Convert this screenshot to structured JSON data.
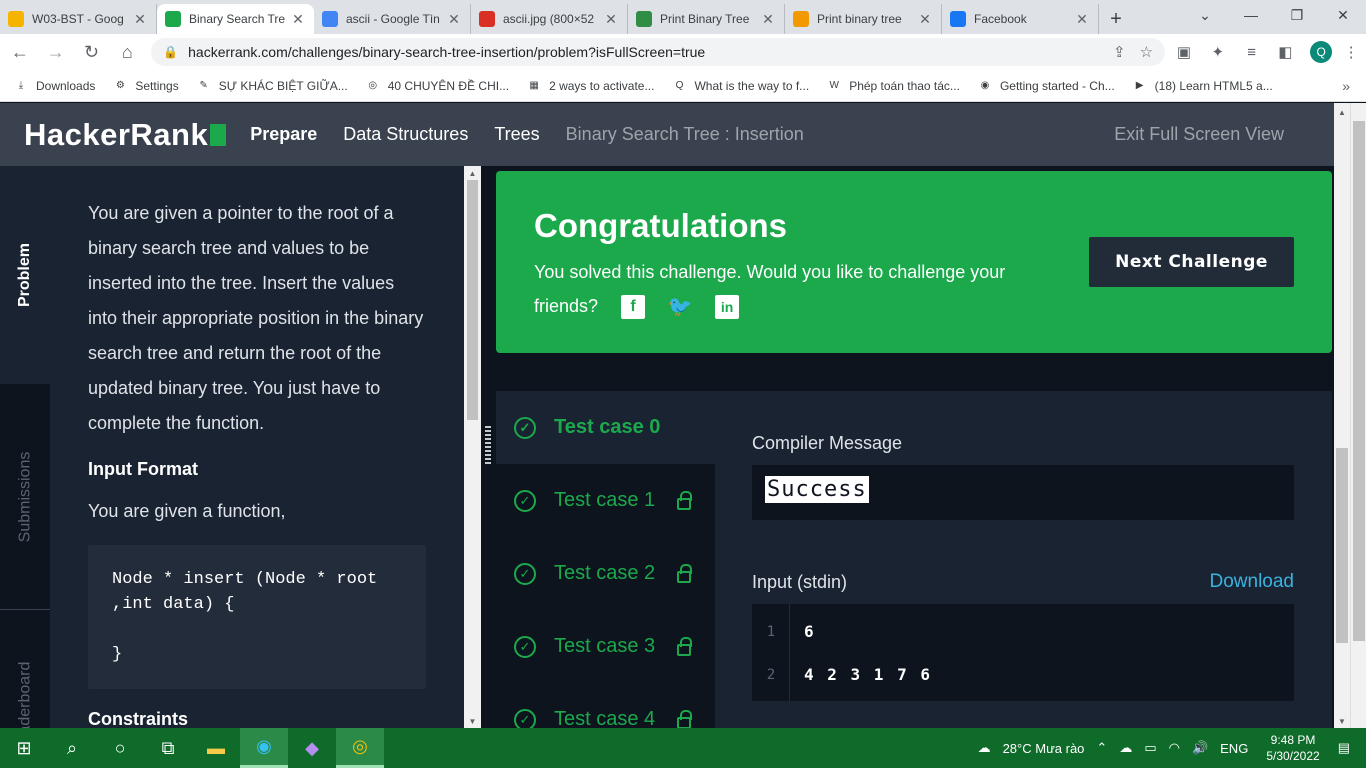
{
  "browser": {
    "tabs": [
      {
        "title": "W03-BST - Goog",
        "icon": "google-drive-icon",
        "color": "#f4b400",
        "active": false
      },
      {
        "title": "Binary Search Tre",
        "icon": "hackerrank-icon",
        "color": "#1ba94c",
        "active": true
      },
      {
        "title": "ascii - Google Tìn",
        "icon": "google-icon",
        "color": "#4285f4",
        "active": false
      },
      {
        "title": "ascii.jpg (800×52",
        "icon": "image-file-icon",
        "color": "#d93025",
        "active": false
      },
      {
        "title": "Print Binary Tree",
        "icon": "gfg-icon",
        "color": "#2f8d46",
        "active": false
      },
      {
        "title": "Print binary tree",
        "icon": "bookmark-icon",
        "color": "#f29900",
        "active": false
      },
      {
        "title": "Facebook",
        "icon": "facebook-icon",
        "color": "#1877f2",
        "active": false
      }
    ],
    "url": "hackerrank.com/challenges/binary-search-tree-insertion/problem?isFullScreen=true",
    "profile_initial": "Q"
  },
  "bookmarks": [
    {
      "label": "Downloads",
      "icon": "download-icon"
    },
    {
      "label": "Settings",
      "icon": "gear-icon"
    },
    {
      "label": "SỰ KHÁC BIỆT GIỮA...",
      "icon": "note-icon"
    },
    {
      "label": "40 CHUYÊN ĐỀ CHI...",
      "icon": "target-icon"
    },
    {
      "label": "2 ways to activate...",
      "icon": "windows-icon"
    },
    {
      "label": "What is the way to f...",
      "icon": "quora-icon"
    },
    {
      "label": "Phép toán thao tác...",
      "icon": "wikipedia-icon"
    },
    {
      "label": "Getting started - Ch...",
      "icon": "chrome-icon"
    },
    {
      "label": "(18) Learn HTML5 a...",
      "icon": "youtube-icon"
    }
  ],
  "header": {
    "logo": "HackerRank",
    "crumbs": [
      "Prepare",
      "Data Structures",
      "Trees",
      "Binary Search Tree : Insertion"
    ],
    "exit_fullscreen": "Exit Full Screen View"
  },
  "side_tabs": {
    "problem": "Problem",
    "submissions": "Submissions",
    "leaderboard": "Leaderboard"
  },
  "problem": {
    "intro": "You are given a pointer to the root of a binary search tree and values to be inserted into the tree. Insert the values into their appropriate position in the binary search tree and return the root of the updated binary tree. You just have to complete the function.",
    "input_format_heading": "Input Format",
    "input_format_text": "You are given a function,",
    "code": "Node * insert (Node * root\n,int data) {\n\n}",
    "constraints_heading": "Constraints"
  },
  "congrats": {
    "title": "Congratulations",
    "message": "You solved this challenge. Would you like to challenge your friends?",
    "next_button": "Next Challenge"
  },
  "test_cases": [
    {
      "label": "Test case 0",
      "locked": false,
      "active": true
    },
    {
      "label": "Test case 1",
      "locked": true,
      "active": false
    },
    {
      "label": "Test case 2",
      "locked": true,
      "active": false
    },
    {
      "label": "Test case 3",
      "locked": true,
      "active": false
    },
    {
      "label": "Test case 4",
      "locked": true,
      "active": false
    }
  ],
  "result": {
    "compiler_label": "Compiler Message",
    "compiler_message": "Success",
    "input_label": "Input (stdin)",
    "download": "Download",
    "input_lines": [
      {
        "n": "1",
        "text": "6"
      },
      {
        "n": "2",
        "text": "4 2 3 1 7 6"
      }
    ]
  },
  "taskbar": {
    "weather": "28°C  Mưa rào",
    "language": "ENG",
    "time": "9:48 PM",
    "date": "5/30/2022"
  }
}
